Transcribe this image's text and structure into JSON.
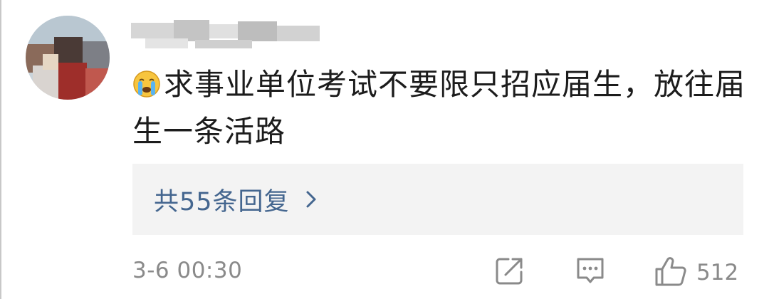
{
  "comment": {
    "emoji": "crying-face-emoji",
    "text": "求事业单位考试不要限只招应届生，放往届生一条活路",
    "replies_label": "共55条回复",
    "timestamp": "3-6 00:30",
    "like_count": "512"
  },
  "icons": {
    "share": "share-icon",
    "comment": "comment-icon",
    "like": "thumbs-up-icon",
    "chevron": "chevron-right-icon"
  },
  "colors": {
    "text": "#1c1c1c",
    "link": "#44668f",
    "muted": "#8a8a8a",
    "reply_bg": "#f3f3f3"
  }
}
